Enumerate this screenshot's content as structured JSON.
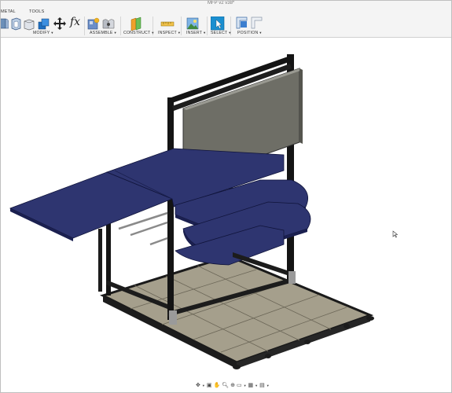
{
  "window": {
    "doc_title": "MFP v2 v38*"
  },
  "tabs": [
    {
      "label": "METAL"
    },
    {
      "label": "TOOLS"
    }
  ],
  "groups": {
    "modify": "MODIFY",
    "assemble": "ASSEMBLE",
    "construct": "CONSTRUCT",
    "inspect": "INSPECT",
    "insert": "INSERT",
    "select": "SELECT",
    "position": "POSITION"
  },
  "icons": {
    "modify": [
      "fillet-icon",
      "shell-icon",
      "combine-icon",
      "move-icon",
      "parameters-fx-icon"
    ],
    "assemble": [
      "new-component-icon",
      "joint-icon"
    ],
    "construct": [
      "offset-plane-icon"
    ],
    "inspect": [
      "measure-icon"
    ],
    "insert": [
      "insert-image-icon"
    ],
    "select": [
      "select-cursor-icon"
    ],
    "position": [
      "capture-position-icon",
      "revert-position-icon"
    ]
  },
  "fx_label": "fx",
  "navbar": {
    "icons": [
      "orbit-icon",
      "look-at-icon",
      "pan-icon",
      "zoom-icon",
      "fit-icon",
      "display-settings-icon",
      "grid-icon",
      "viewports-icon"
    ]
  },
  "colors": {
    "toolbar_bg": "#f4f4f4",
    "panel_blue": "#2e3570",
    "frame_black": "#141414",
    "floor_tan": "#a59f8c",
    "screen_gray": "#6e6e66",
    "select_accent": "#1a8fd0"
  }
}
